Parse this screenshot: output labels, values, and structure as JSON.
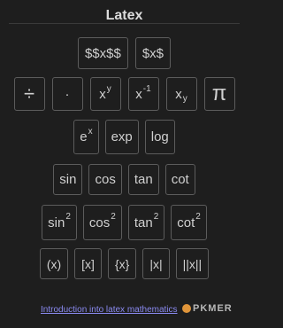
{
  "header": {
    "title": "Latex"
  },
  "rows": {
    "r1": [
      {
        "label": "$$x$$"
      },
      {
        "label": "$x$"
      }
    ],
    "r2": [
      {
        "label": "÷"
      },
      {
        "label": "·"
      },
      {
        "base": "x",
        "sup": "y"
      },
      {
        "base": "x",
        "sup": "-1"
      },
      {
        "base": "x",
        "sub": "y"
      },
      {
        "label": "π"
      }
    ],
    "r3": [
      {
        "base": "e",
        "sup": "x"
      },
      {
        "label": "exp"
      },
      {
        "label": "log"
      }
    ],
    "r4": [
      {
        "label": "sin"
      },
      {
        "label": "cos"
      },
      {
        "label": "tan"
      },
      {
        "label": "cot"
      }
    ],
    "r5": [
      {
        "base": "sin",
        "sup": "2"
      },
      {
        "base": "cos",
        "sup": "2"
      },
      {
        "base": "tan",
        "sup": "2"
      },
      {
        "base": "cot",
        "sup": "2"
      }
    ],
    "r6": [
      {
        "label": "(x)"
      },
      {
        "label": "[x]"
      },
      {
        "label": "{x}"
      },
      {
        "label": "|x|"
      },
      {
        "label": "||x||"
      }
    ]
  },
  "footer": {
    "link_text": "Introduction into latex mathematics"
  },
  "watermark": {
    "text": "PKMER"
  }
}
